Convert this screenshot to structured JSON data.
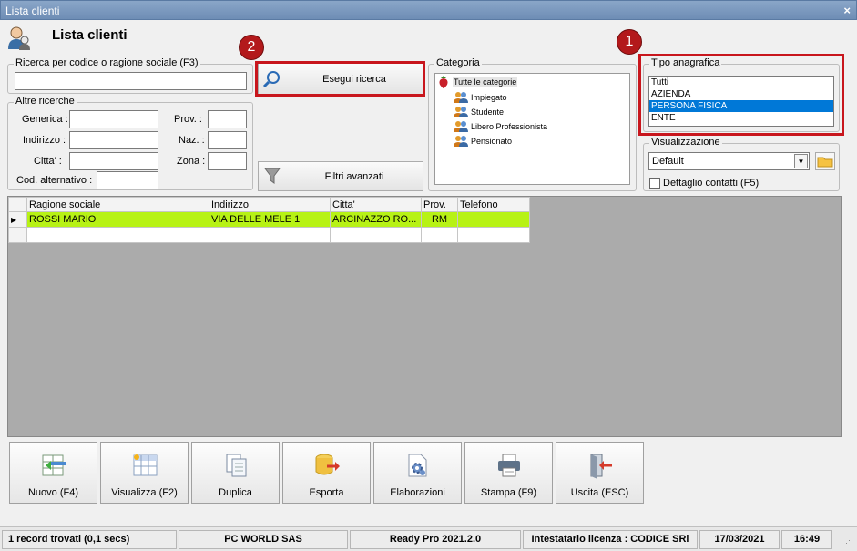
{
  "window": {
    "title": "Lista clienti"
  },
  "header": {
    "title": "Lista clienti"
  },
  "search": {
    "group_label": "Ricerca per codice o ragione sociale (F3)",
    "value": "",
    "button_label": "Esegui ricerca",
    "filters_label": "Filtri avanzati"
  },
  "other_search": {
    "group_label": "Altre ricerche",
    "fields": {
      "generica": "Generica :",
      "indirizzo": "Indirizzo :",
      "citta": "Citta' :",
      "cod_alt": "Cod. alternativo :",
      "prov": "Prov. :",
      "naz": "Naz. :",
      "zona": "Zona :"
    }
  },
  "categoria": {
    "group_label": "Categoria",
    "root": "Tutte le categorie",
    "items": [
      "Impiegato",
      "Studente",
      "Libero Professionista",
      "Pensionato"
    ]
  },
  "tipo": {
    "group_label": "Tipo anagrafica",
    "options": [
      "Tutti",
      "AZIENDA",
      "PERSONA FISICA",
      "ENTE"
    ],
    "selected": "PERSONA FISICA"
  },
  "visualizzazione": {
    "group_label": "Visualizzazione",
    "selected": "Default",
    "checkbox_label": "Dettaglio contatti (F5)",
    "checked": false
  },
  "badges": {
    "one": "1",
    "two": "2"
  },
  "table": {
    "columns": [
      "Ragione sociale",
      "Indirizzo",
      "Citta'",
      "Prov.",
      "Telefono"
    ],
    "rows": [
      [
        "ROSSI MARIO",
        "VIA DELLE MELE 1",
        "ARCINAZZO RO...",
        "RM",
        ""
      ]
    ]
  },
  "toolbar": {
    "nuovo": "Nuovo (F4)",
    "visualizza": "Visualizza (F2)",
    "duplica": "Duplica",
    "esporta": "Esporta",
    "elaborazioni": "Elaborazioni",
    "stampa": "Stampa (F9)",
    "uscita": "Uscita (ESC)"
  },
  "status": {
    "records": "1 record trovati (0,1 secs)",
    "company": "PC WORLD SAS",
    "version": "Ready Pro 2021.2.0",
    "license": "Intestatario licenza : CODICE SRl",
    "date": "17/03/2021",
    "time": "16:49"
  },
  "colors": {
    "accent_red": "#c8161d",
    "row_highlight": "#b7f215",
    "selection": "#0078d7"
  }
}
